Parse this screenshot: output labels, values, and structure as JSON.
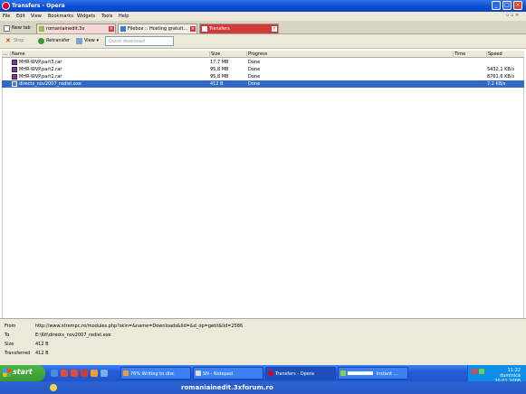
{
  "window": {
    "title": "Transfers - Opera"
  },
  "menu": [
    "File",
    "Edit",
    "View",
    "Bookmarks",
    "Widgets",
    "Tools",
    "Help"
  ],
  "tabs": {
    "new_tab": "New tab",
    "items": [
      {
        "label": "romaniainedit.3x",
        "favicon": "site-icon"
      },
      {
        "label": "Filebox :: Hosting gratuit...",
        "favicon": "filebox-icon"
      },
      {
        "label": "Transfers",
        "favicon": "transfers-icon"
      }
    ]
  },
  "toolbar": {
    "stop": "Stop",
    "retransfer": "Retransfer",
    "view": "View",
    "quick_download_placeholder": "Quick download"
  },
  "columns": [
    "Name",
    "Size",
    "Progress",
    "Time",
    "Speed"
  ],
  "rows": [
    {
      "name": "MHR-WVP.part3.rar",
      "size": "17,7 MB",
      "progress": "Done",
      "time": "",
      "speed": ""
    },
    {
      "name": "MHR-WVP.part2.rar",
      "size": "95,8 MB",
      "progress": "Done",
      "time": "",
      "speed": "5432,1 KB/s"
    },
    {
      "name": "MHR-WVP.part1.rar",
      "size": "95,8 MB",
      "progress": "Done",
      "time": "",
      "speed": "8761,6 KB/s"
    },
    {
      "name": "directx_nov2007_redist.exe",
      "size": "412 B",
      "progress": "Done",
      "time": "",
      "speed": "7,2 KB/s"
    }
  ],
  "details": {
    "from_label": "From",
    "from_value": "http://www.xtrempc.ro/modules.php?skin=&name=Downloads&lid=&d_op=getit&lid=2586",
    "to_label": "To",
    "to_value": "E:\\Kit\\directx_nov2007_redist.exe",
    "size_label": "Size",
    "size_value": "412 B",
    "transferred_label": "Transferred",
    "transferred_value": "412 B"
  },
  "taskbar": {
    "start": "start",
    "tasks": [
      "76% Writing to disc",
      "SN - Notepad",
      "Transfers - Opera",
      "Instant ..."
    ],
    "clock_time": "11:22",
    "clock_day": "duminică",
    "clock_date": "20.01.2008"
  },
  "watermark": "romaniainedit.3xforum.ro",
  "colors": {
    "accent": "#0a4fd6",
    "selection": "#316ac5",
    "tab_active": "#d23a3a"
  }
}
